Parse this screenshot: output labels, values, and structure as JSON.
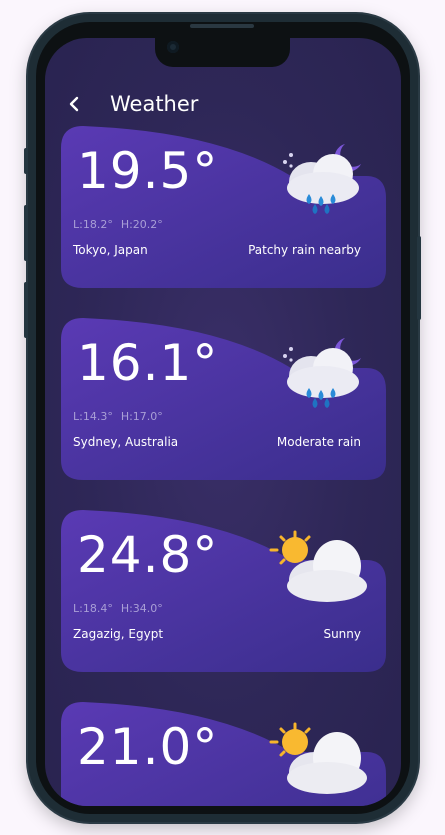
{
  "header": {
    "title": "Weather",
    "back_icon": "chevron-left-icon"
  },
  "cards": [
    {
      "temp": "19.5°",
      "low": "L:18.2°",
      "high": "H:20.2°",
      "city": "Tokyo, Japan",
      "condition": "Patchy rain nearby",
      "icon": "rain-night-cloud-icon"
    },
    {
      "temp": "16.1°",
      "low": "L:14.3°",
      "high": "H:17.0°",
      "city": "Sydney, Australia",
      "condition": "Moderate rain",
      "icon": "rain-night-cloud-icon"
    },
    {
      "temp": "24.8°",
      "low": "L:18.4°",
      "high": "H:34.0°",
      "city": "Zagazig, Egypt",
      "condition": "Sunny",
      "icon": "sun-cloud-icon"
    },
    {
      "temp": "21.0°",
      "icon": "sun-cloud-icon"
    }
  ],
  "colors": {
    "card_top": "#5a3ab4",
    "card_bottom": "#3a2e8c",
    "screen_bg": "#2e2757"
  }
}
